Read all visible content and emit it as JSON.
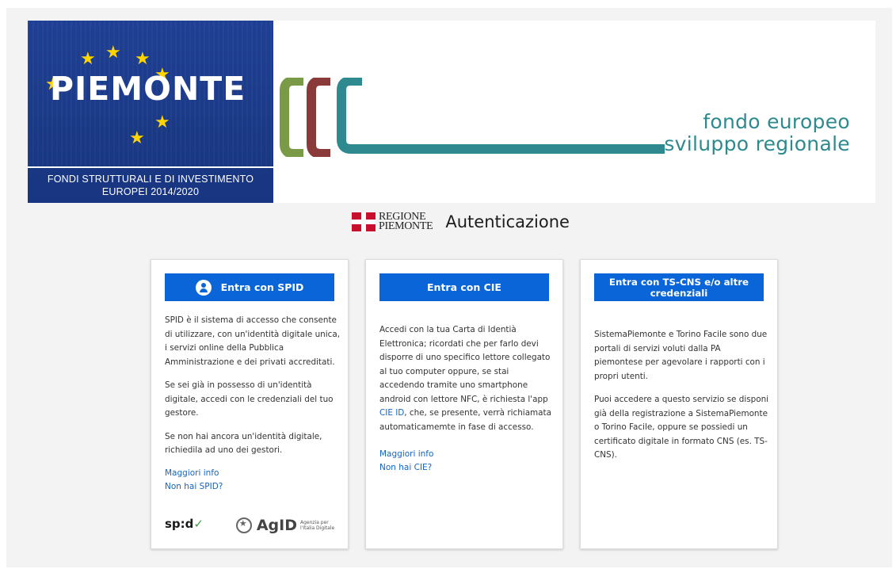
{
  "banner": {
    "piemonte_word": "PIEMONTE",
    "fondi_line1": "FONDI STRUTTURALI E DI INVESTIMENTO",
    "fondi_line2": "EUROPEI 2014/2020",
    "fesr_line1": "fondo europeo",
    "fesr_line2": "sviluppo regionale"
  },
  "header": {
    "regione_line1": "REGIONE",
    "regione_line2": "PIEMONTE",
    "title": "Autenticazione"
  },
  "spid": {
    "button_label": "Entra con SPID",
    "p1": "SPID è il sistema di accesso che consente di utilizzare, con un'identità digitale unica, i servizi online della Pubblica Amministrazione e dei privati accreditati.",
    "p2": "Se sei già in possesso di un'identità digitale, accedi con le credenziali del tuo gestore.",
    "p3": "Se non hai ancora un'identità digitale, richiedila ad uno dei gestori.",
    "link_info": "Maggiori info",
    "link_no": "Non hai SPID?",
    "spid_logo": "sp:d",
    "agid_word": "AgID",
    "agid_sub": "Agenzia per l'Italia Digitale"
  },
  "cie": {
    "button_label": "Entra con CIE",
    "p1_before": "Accedi con la tua Carta di Identià Elettronica; ricordati che per farlo devi disporre di uno specifico lettore collegato al tuo computer oppure, se stai accedendo tramite uno smartphone android con lettore NFC, è richiesta l'app ",
    "p1_link": "CIE ID",
    "p1_after": ", che, se presente, verrà richiamata automaticamemte in fase di accesso.",
    "link_info": "Maggiori info",
    "link_no": "Non hai CIE?"
  },
  "tscns": {
    "button_label": "Entra con TS-CNS e/o altre credenziali",
    "p1": "SistemaPiemonte e Torino Facile sono due portali di servizi voluti dalla PA piemontese per agevolare i rapporti con i propri utenti.",
    "p2": "Puoi accedere a questo servizio se disponi già della registrazione a SistemaPiemonte o Torino Facile, oppure se possiedi un certificato digitale in formato CNS (es. TS-CNS)."
  },
  "colors": {
    "button_blue": "#0a66d8",
    "link_blue": "#1565c0",
    "piemonte_blue": "#1a3985",
    "star_yellow": "#ffd400",
    "fesr_teal": "#2e8a8e",
    "fesr_green": "#7a9a48",
    "fesr_red": "#8b3a3a"
  }
}
